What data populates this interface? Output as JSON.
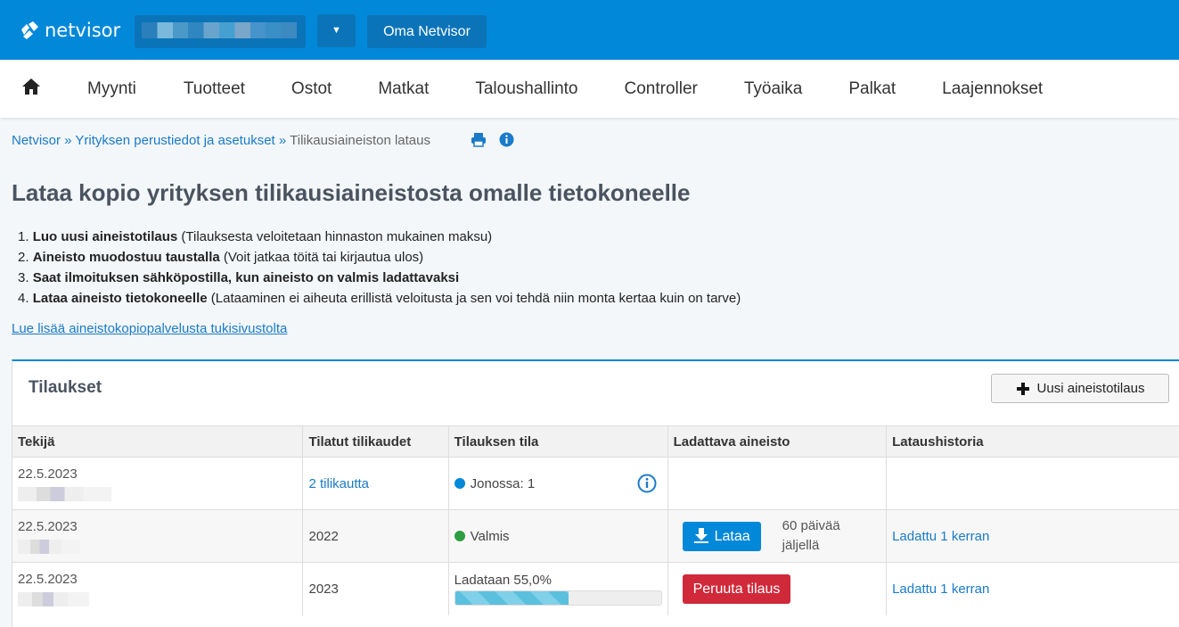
{
  "header": {
    "logo": "netvisor",
    "company_switch": "",
    "oma": "Oma Netvisor"
  },
  "nav": [
    "Myynti",
    "Tuotteet",
    "Ostot",
    "Matkat",
    "Taloushallinto",
    "Controller",
    "Työaika",
    "Palkat",
    "Laajennokset"
  ],
  "breadcrumb": {
    "b1": "Netvisor",
    "b2": "Yrityksen perustiedot ja asetukset",
    "current": "Tilikausiaineiston lataus",
    "sep": " » "
  },
  "title": "Lataa kopio yrityksen tilikausiaineistosta omalle tietokoneelle",
  "steps": [
    {
      "n": "1.",
      "bold": "Luo uusi aineistotilaus",
      "rest": " (Tilauksesta veloitetaan hinnaston mukainen maksu)"
    },
    {
      "n": "2.",
      "bold": "Aineisto muodostuu taustalla",
      "rest": " (Voit jatkaa töitä tai kirjautua ulos)"
    },
    {
      "n": "3.",
      "bold": "Saat ilmoituksen sähköpostilla, kun aineisto on valmis ladattavaksi",
      "rest": ""
    },
    {
      "n": "4.",
      "bold": "Lataa aineisto tietokoneelle",
      "rest": " (Lataaminen ei aiheuta erillistä veloitusta ja sen voi tehdä niin monta kertaa kuin on tarve)"
    }
  ],
  "more_link": "Lue lisää aineistokopiopalvelusta tukisivustolta",
  "panel": {
    "title": "Tilaukset",
    "new_button": "Uusi aineistotilaus"
  },
  "table": {
    "headers": [
      "Tekijä",
      "Tilatut tilikaudet",
      "Tilauksen tila",
      "Ladattava aineisto",
      "Lataushistoria"
    ],
    "rows": [
      {
        "date": "22.5.2023",
        "periods": "2 tilikautta",
        "status": "Jonossa: 1",
        "status_color": "#0288d8"
      },
      {
        "date": "22.5.2023",
        "periods": "2022",
        "status": "Valmis",
        "status_color": "#2e9e44",
        "download": "Lataa",
        "remaining": "60 päivää jäljellä",
        "history": "Ladattu 1 kerran"
      },
      {
        "date": "22.5.2023",
        "periods": "2023",
        "status": "Ladataan 55,0%",
        "progress": 55.0,
        "cancel": "Peruuta tilaus",
        "history": "Ladattu 1 kerran"
      }
    ]
  }
}
